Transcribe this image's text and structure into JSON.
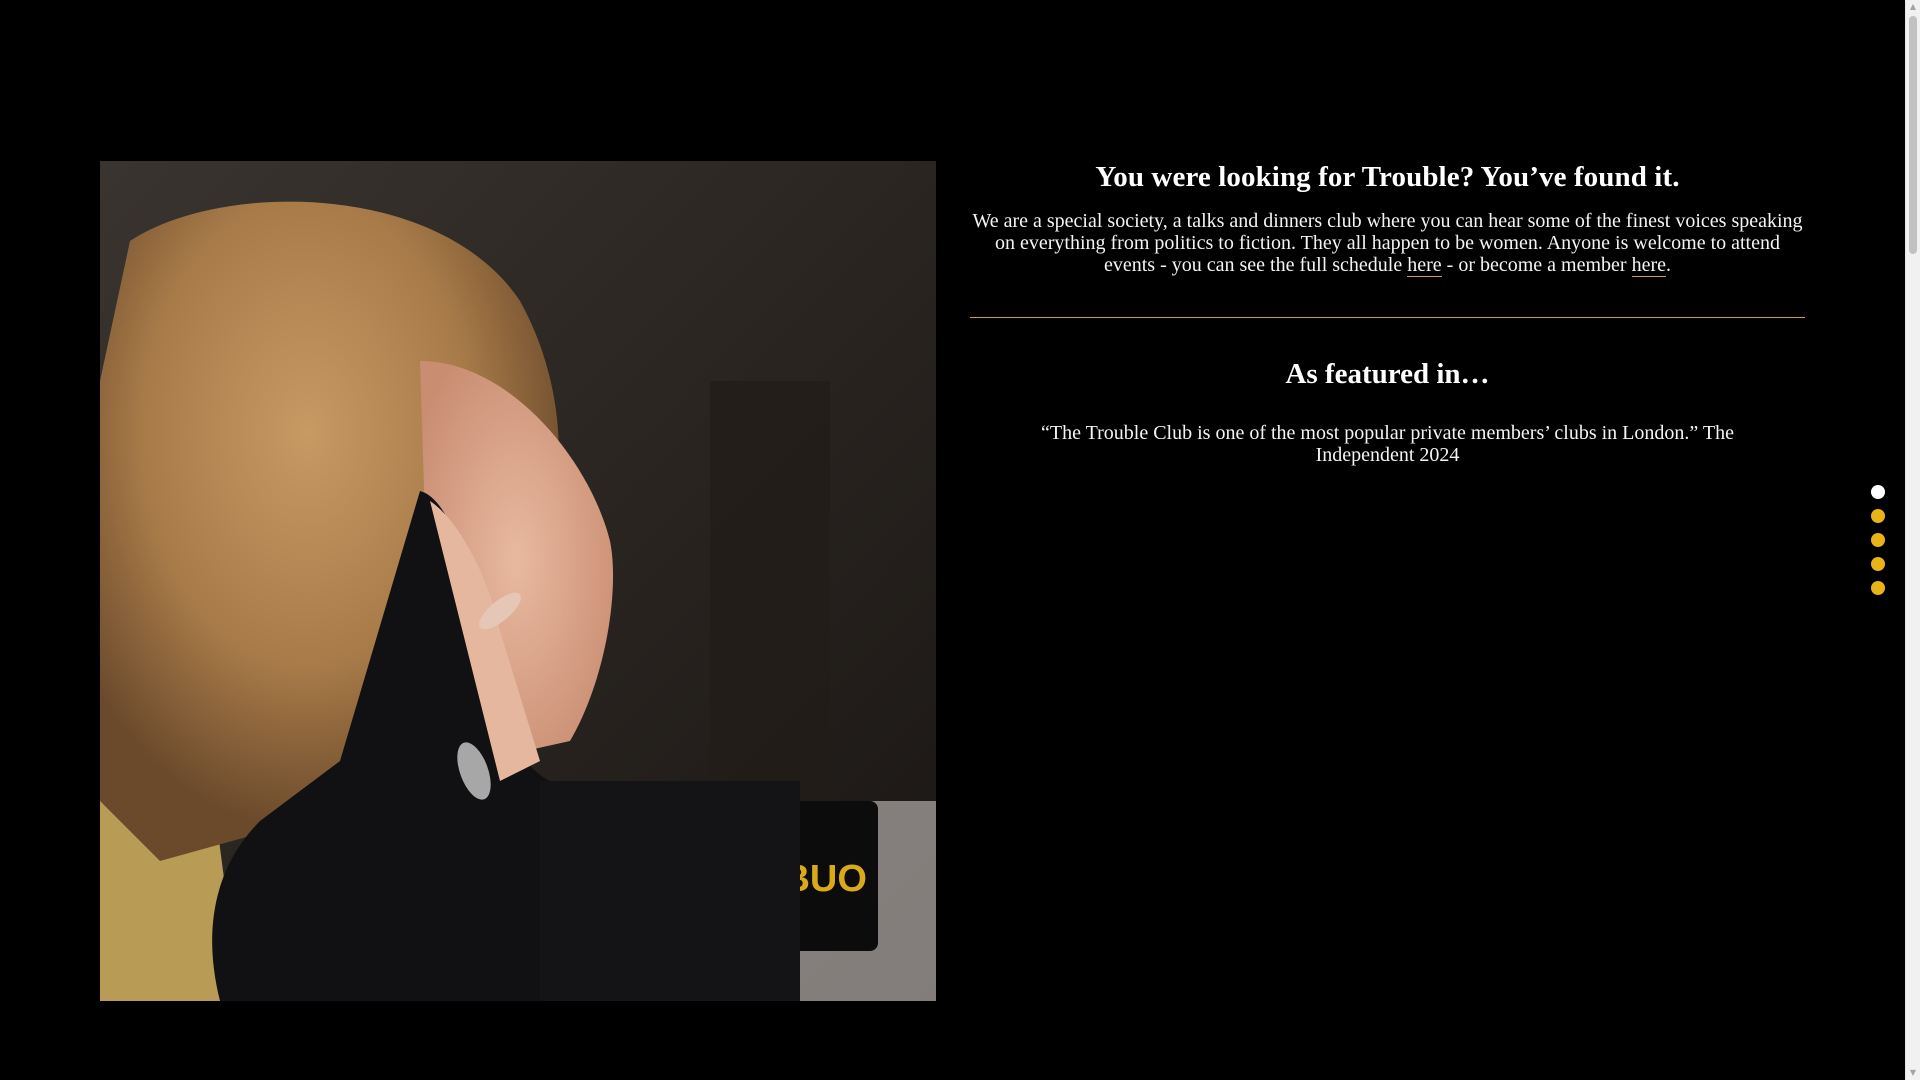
{
  "hero": {
    "headline": "You were looking for Trouble? You’ve found it.",
    "intro_before_link1": "We are a special society, a talks and dinners club where you can hear some of the finest voices speaking on everything from politics to fiction. They all happen to be women. Anyone is welcome to attend events - you can see the full schedule ",
    "link1_label": "here",
    "intro_between_links": " - or become a member ",
    "link2_label": "here",
    "intro_after_link2": "."
  },
  "featured": {
    "title": "As featured in…",
    "quote": "“The Trouble Club is one of the most popular private members’ clubs in London.” The Independent 2024"
  },
  "section_nav": {
    "count": 5,
    "active_index": 0
  },
  "colors": {
    "background": "#000000",
    "accent": "#e8b319",
    "divider": "#c9a33a",
    "text": "#ffffff"
  }
}
